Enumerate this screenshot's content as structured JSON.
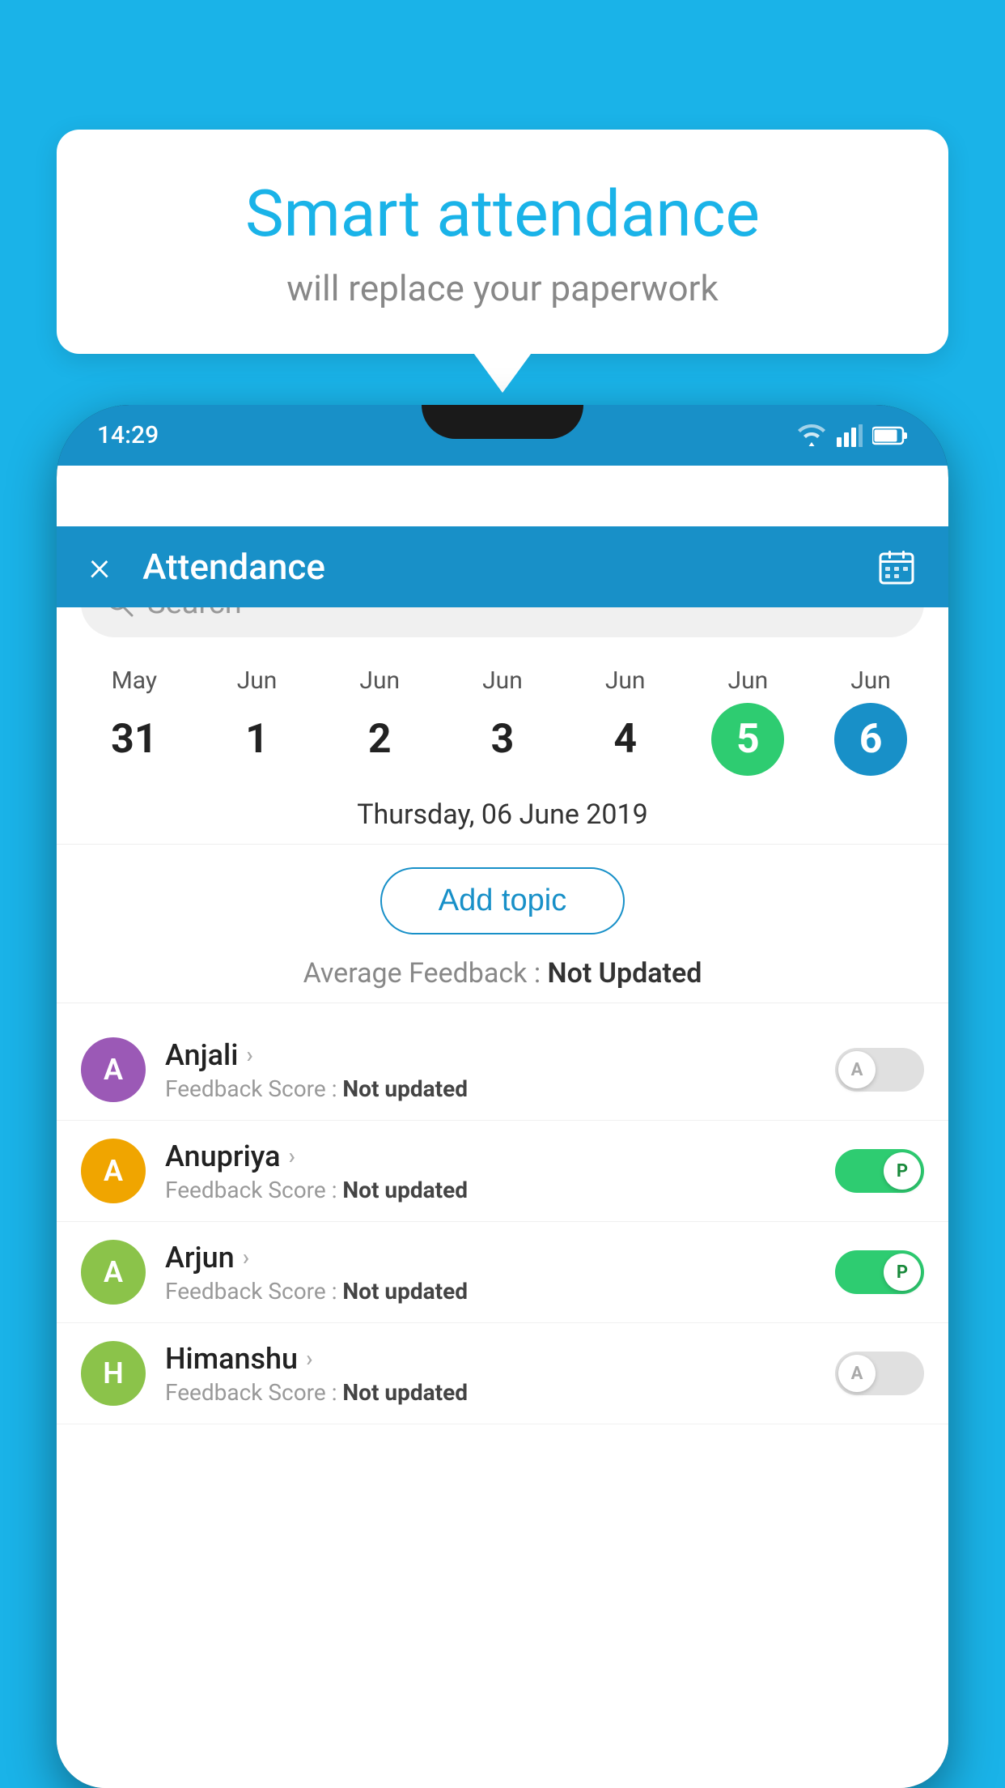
{
  "background_color": "#1ab3e8",
  "bubble": {
    "title": "Smart attendance",
    "subtitle": "will replace your paperwork"
  },
  "status_bar": {
    "time": "14:29",
    "wifi_icon": "wifi",
    "signal_icon": "signal",
    "battery_icon": "battery"
  },
  "app_header": {
    "close_label": "×",
    "title": "Attendance",
    "calendar_icon": "calendar"
  },
  "search": {
    "placeholder": "Search"
  },
  "dates": [
    {
      "month": "May",
      "day": "31",
      "state": "normal"
    },
    {
      "month": "Jun",
      "day": "1",
      "state": "normal"
    },
    {
      "month": "Jun",
      "day": "2",
      "state": "normal"
    },
    {
      "month": "Jun",
      "day": "3",
      "state": "normal"
    },
    {
      "month": "Jun",
      "day": "4",
      "state": "normal"
    },
    {
      "month": "Jun",
      "day": "5",
      "state": "today"
    },
    {
      "month": "Jun",
      "day": "6",
      "state": "selected"
    }
  ],
  "selected_date_label": "Thursday, 06 June 2019",
  "add_topic_button": "Add topic",
  "avg_feedback_label": "Average Feedback : ",
  "avg_feedback_value": "Not Updated",
  "students": [
    {
      "name": "Anjali",
      "avatar_letter": "A",
      "avatar_color": "#9b59b6",
      "feedback_label": "Feedback Score : ",
      "feedback_value": "Not updated",
      "toggle": "off",
      "toggle_letter": "A"
    },
    {
      "name": "Anupriya",
      "avatar_letter": "A",
      "avatar_color": "#f0a500",
      "feedback_label": "Feedback Score : ",
      "feedback_value": "Not updated",
      "toggle": "on",
      "toggle_letter": "P"
    },
    {
      "name": "Arjun",
      "avatar_letter": "A",
      "avatar_color": "#8bc34a",
      "feedback_label": "Feedback Score : ",
      "feedback_value": "Not updated",
      "toggle": "on",
      "toggle_letter": "P"
    },
    {
      "name": "Himanshu",
      "avatar_letter": "H",
      "avatar_color": "#8bc34a",
      "feedback_label": "Feedback Score : ",
      "feedback_value": "Not updated",
      "toggle": "off",
      "toggle_letter": "A"
    }
  ]
}
